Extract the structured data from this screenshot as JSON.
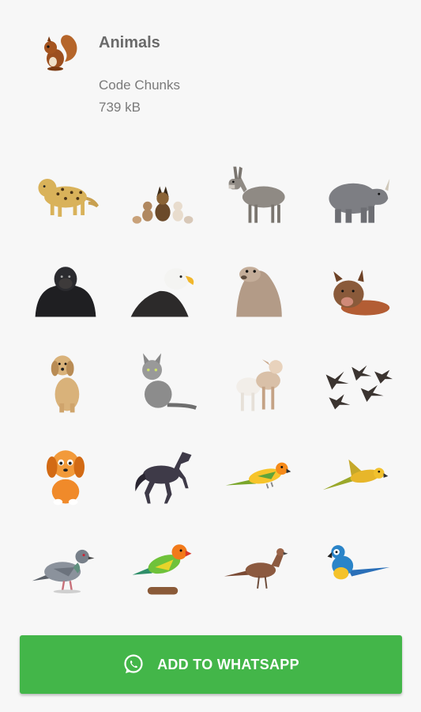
{
  "pack": {
    "icon": "squirrel-icon",
    "title": "Animals",
    "author": "Code Chunks",
    "size": "739 kB"
  },
  "stickers": [
    {
      "name": "leopard"
    },
    {
      "name": "dogs-and-cats"
    },
    {
      "name": "donkey"
    },
    {
      "name": "rhinoceros"
    },
    {
      "name": "gorilla"
    },
    {
      "name": "bald-eagle"
    },
    {
      "name": "sea-lion"
    },
    {
      "name": "pig"
    },
    {
      "name": "golden-retriever"
    },
    {
      "name": "cat"
    },
    {
      "name": "lambs"
    },
    {
      "name": "flying-geese"
    },
    {
      "name": "cartoon-puppy"
    },
    {
      "name": "horse"
    },
    {
      "name": "sun-conure"
    },
    {
      "name": "flying-parrot"
    },
    {
      "name": "pigeon"
    },
    {
      "name": "lovebird"
    },
    {
      "name": "pheasant"
    },
    {
      "name": "macaw"
    }
  ],
  "add_button": {
    "icon": "whatsapp-icon",
    "label": "ADD TO WHATSAPP",
    "color": "#43b649"
  }
}
